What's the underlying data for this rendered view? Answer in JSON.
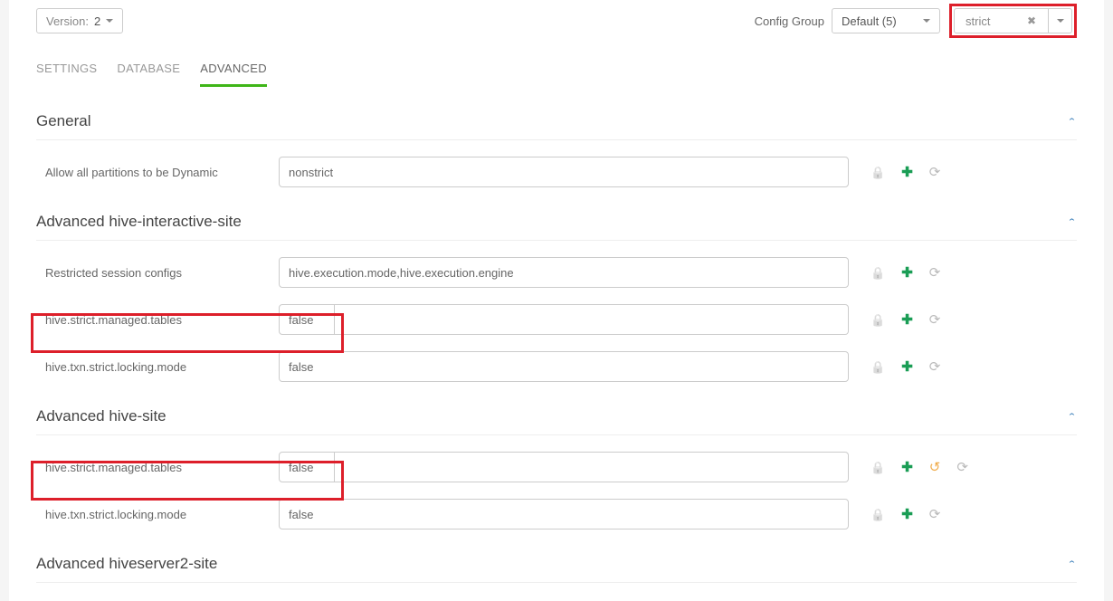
{
  "topbar": {
    "version_label": "Version:",
    "version_value": "2",
    "config_group_label": "Config Group",
    "config_group_value": "Default (5)",
    "filter_value": "strict"
  },
  "tabs": {
    "settings": "SETTINGS",
    "database": "DATABASE",
    "advanced": "ADVANCED"
  },
  "panels": {
    "general": {
      "title": "General",
      "rows": [
        {
          "label": "Allow all partitions to be Dynamic",
          "value": "nonstrict"
        }
      ]
    },
    "hive_interactive": {
      "title": "Advanced hive-interactive-site",
      "rows": [
        {
          "label": "Restricted session configs",
          "value": "hive.execution.mode,hive.execution.engine"
        },
        {
          "label": "hive.strict.managed.tables",
          "value": "false"
        },
        {
          "label": "hive.txn.strict.locking.mode",
          "value": "false"
        }
      ]
    },
    "hive_site": {
      "title": "Advanced hive-site",
      "rows": [
        {
          "label": "hive.strict.managed.tables",
          "value": "false"
        },
        {
          "label": "hive.txn.strict.locking.mode",
          "value": "false"
        }
      ]
    },
    "hiveserver2": {
      "title": "Advanced hiveserver2-site"
    }
  }
}
